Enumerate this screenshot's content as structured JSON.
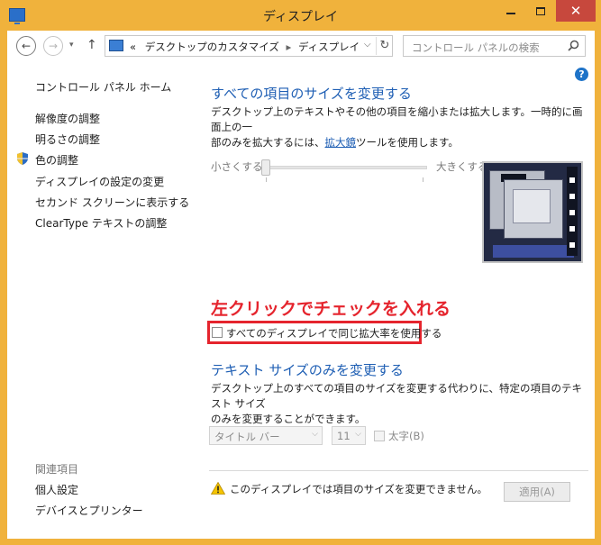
{
  "window": {
    "title": "ディスプレイ",
    "minimize_glyph": "—",
    "close_glyph": "✕",
    "accent_color": "#f0b23c",
    "close_color": "#c7483d"
  },
  "nav": {
    "back_glyph": "←",
    "forward_glyph": "→",
    "up_glyph": "↑",
    "breadcrumb_prefix": "«",
    "breadcrumb": [
      "デスクトップのカスタマイズ",
      "ディスプレイ"
    ],
    "breadcrumb_sep": "▸",
    "search_placeholder": "コントロール パネルの検索"
  },
  "sidebar": {
    "home": "コントロール パネル ホーム",
    "items": [
      "解像度の調整",
      "明るさの調整",
      "色の調整",
      "ディスプレイの設定の変更",
      "セカンド スクリーンに表示する",
      "ClearType テキストの調整"
    ],
    "related_heading": "関連項目",
    "related": [
      "個人設定",
      "デバイスとプリンター"
    ]
  },
  "main": {
    "section1_title": "すべての項目のサイズを変更する",
    "section1_text_a": "デスクトップ上のテキストやその他の項目を縮小または拡大します。一時的に画面上の一",
    "section1_text_b_pre": "部のみを拡大するには、",
    "section1_link": "拡大鏡",
    "section1_text_b_post": "ツールを使用します。",
    "slider_min_label": "小さくする",
    "slider_max_label": "大きくする",
    "slider_value": 0,
    "annotation": "左クリックでチェックを入れる",
    "same_scale_checkbox": "すべてのディスプレイで同じ拡大率を使用する",
    "same_scale_checked": false,
    "section2_title": "テキスト サイズのみを変更する",
    "section2_text_a": "デスクトップ上のすべての項目のサイズを変更する代わりに、特定の項目のテキスト サイズ",
    "section2_text_b": "のみを変更することができます。",
    "item_select": "タイトル バー",
    "size_select": "11",
    "bold_label": "太字(B)",
    "bold_checked": false,
    "warning": "このディスプレイでは項目のサイズを変更できません。",
    "apply_button": "適用(A)"
  }
}
